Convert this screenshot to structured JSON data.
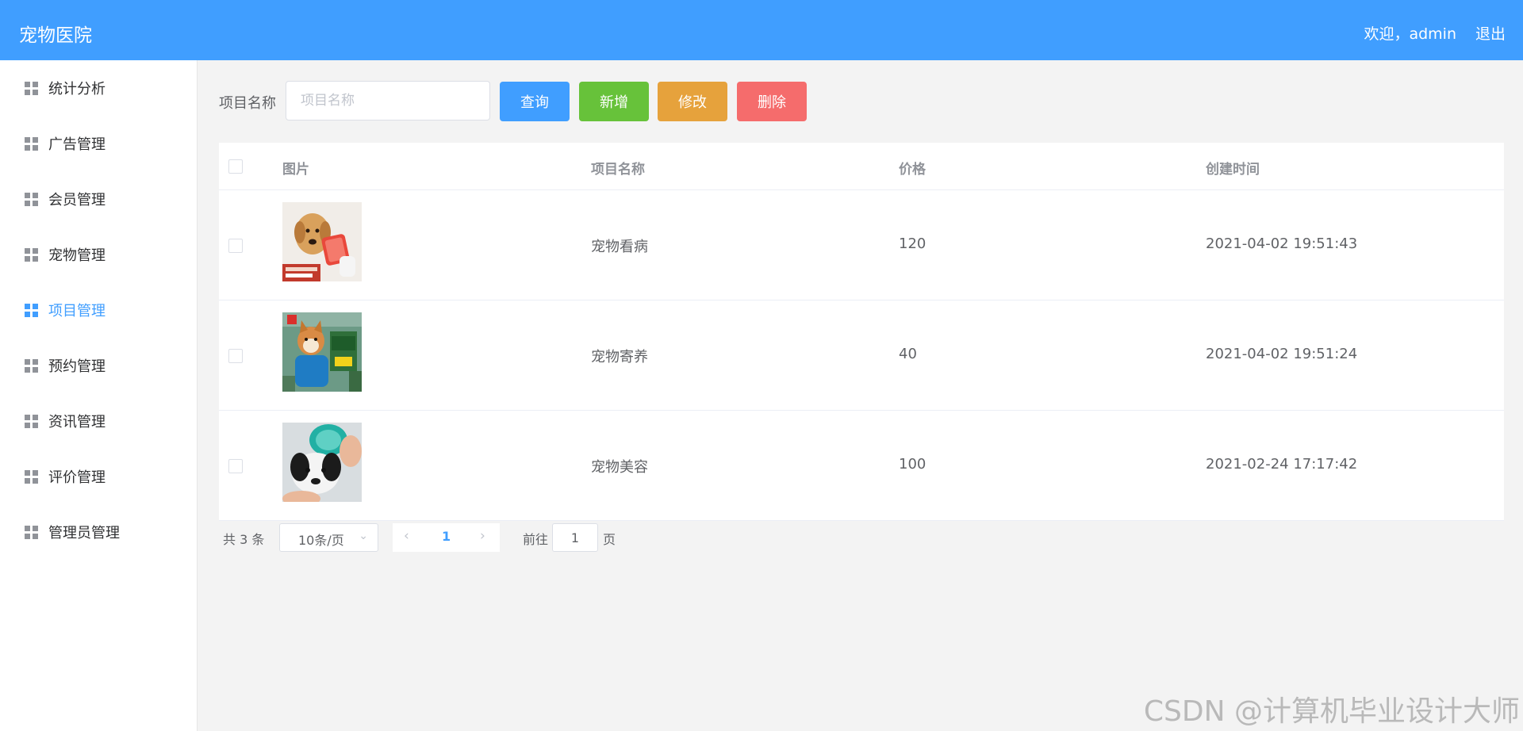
{
  "header": {
    "title": "宠物医院",
    "welcome": "欢迎，admin",
    "logout": "退出"
  },
  "sidebar": {
    "items": [
      {
        "label": "统计分析",
        "active": false
      },
      {
        "label": "广告管理",
        "active": false
      },
      {
        "label": "会员管理",
        "active": false
      },
      {
        "label": "宠物管理",
        "active": false
      },
      {
        "label": "项目管理",
        "active": true
      },
      {
        "label": "预约管理",
        "active": false
      },
      {
        "label": "资讯管理",
        "active": false
      },
      {
        "label": "评价管理",
        "active": false
      },
      {
        "label": "管理员管理",
        "active": false
      }
    ]
  },
  "toolbar": {
    "label": "项目名称",
    "search_placeholder": "项目名称",
    "query": "查询",
    "add": "新增",
    "edit": "修改",
    "delete": "删除"
  },
  "table": {
    "headers": [
      "图片",
      "项目名称",
      "价格",
      "创建时间"
    ],
    "rows": [
      {
        "image": "dog-grooming-brush-photo",
        "name": "宠物看病",
        "price": "120",
        "created": "2021-04-02 19:51:43"
      },
      {
        "image": "shiba-pet-boarding-photo",
        "name": "宠物寄养",
        "price": "40",
        "created": "2021-04-02 19:51:24"
      },
      {
        "image": "dog-bath-brush-photo",
        "name": "宠物美容",
        "price": "100",
        "created": "2021-02-24 17:17:42"
      }
    ]
  },
  "pagination": {
    "total": "共 3 条",
    "page_size": "10条/页",
    "current_page": "1",
    "goto_label": "前往",
    "goto_value": "1",
    "page_unit": "页"
  },
  "watermark": "CSDN @计算机毕业设计大师",
  "colors": {
    "primary": "#409eff",
    "success": "#67c23a",
    "warning": "#e6a23c",
    "danger": "#f56c6c"
  }
}
